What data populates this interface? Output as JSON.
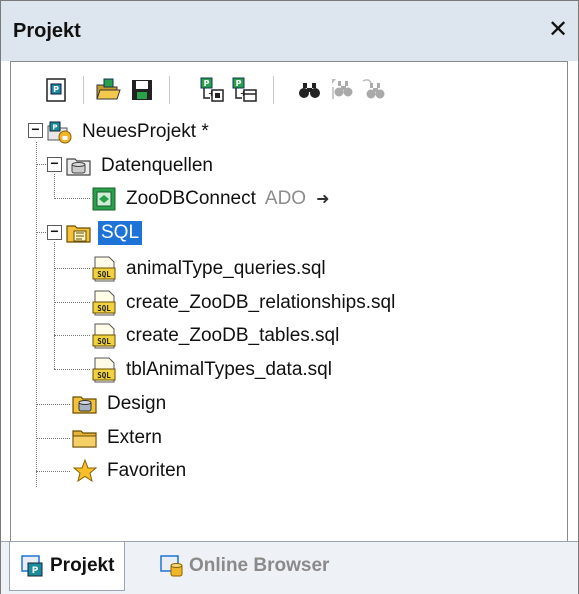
{
  "window": {
    "title": "Projekt",
    "close_symbol": "✕"
  },
  "toolbar": {
    "buttons": [
      {
        "icon": "project-properties-icon"
      },
      {
        "icon": "open-folder-icon"
      },
      {
        "icon": "save-icon"
      },
      {
        "icon": "add-to-project-icon"
      },
      {
        "icon": "add-active-file-icon"
      },
      {
        "icon": "find-icon"
      },
      {
        "icon": "find-next-icon"
      },
      {
        "icon": "find-previous-icon"
      }
    ]
  },
  "tree": {
    "root": {
      "label": "NeuesProjekt *"
    },
    "datasources": {
      "label": "Datenquellen"
    },
    "connection": {
      "label": "ZooDBConnect",
      "type": "ADO",
      "arrow": "➜"
    },
    "sql": {
      "label": "SQL"
    },
    "sql_files": [
      {
        "label": "animalType_queries.sql"
      },
      {
        "label": "create_ZooDB_relationships.sql"
      },
      {
        "label": "create_ZooDB_tables.sql"
      },
      {
        "label": "tblAnimalTypes_data.sql"
      }
    ],
    "design": {
      "label": "Design"
    },
    "extern": {
      "label": "Extern"
    },
    "favorites": {
      "label": "Favoriten"
    },
    "expand_symbol": "−"
  },
  "tabs": [
    {
      "label": "Projekt",
      "active": true
    },
    {
      "label": "Online Browser",
      "active": false
    }
  ],
  "colors": {
    "selection": "#1e73d6",
    "titlebar": "#dde5ee",
    "folder_yellow": "#f3c23a",
    "sql_yellow": "#f0d240",
    "connection_green": "#2aa04a"
  }
}
